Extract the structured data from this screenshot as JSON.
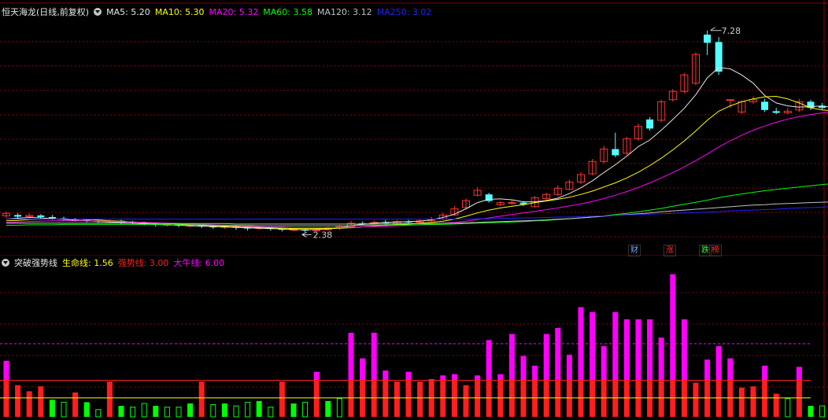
{
  "main_legend": {
    "stock_title": "恒天海龙(日线,前复权)",
    "items": [
      {
        "label": "MA5: 5.20",
        "color": "#e6e6e6"
      },
      {
        "label": "MA10: 5.30",
        "color": "#ffff00"
      },
      {
        "label": "MA20: 5.32",
        "color": "#ff00ff"
      },
      {
        "label": "MA60: 3.58",
        "color": "#00ff00"
      },
      {
        "label": "MA120: 3.12",
        "color": "#c0c0c0"
      },
      {
        "label": "MA250: 3.02",
        "color": "#2222ff"
      }
    ]
  },
  "sub_legend": {
    "title": "突破强势线",
    "items": [
      {
        "label": "生命线: 1.56",
        "color": "#ffff00"
      },
      {
        "label": "强势线: 3.00",
        "color": "#ff2020"
      },
      {
        "label": "大牛线: 6.00",
        "color": "#ff00ff"
      }
    ]
  },
  "annotations": {
    "high_price": "7.28",
    "low_price": "2.38"
  },
  "badges": [
    {
      "text": "财",
      "color": "#6fa8ff"
    },
    {
      "text": "涨",
      "color": "#ff3030"
    },
    {
      "text": "跌",
      "color": "#30ff30"
    },
    {
      "text": "榜",
      "color": "#ff3030"
    }
  ],
  "colors": {
    "up": "#ff3232",
    "down": "#54ffff",
    "grid": "#8b0000"
  },
  "chart_data": [
    {
      "type": "candlestick",
      "title": "恒天海龙(日线,前复权)",
      "ylim": [
        2.1,
        7.6
      ],
      "candles": [
        [
          2.78,
          2.84,
          2.72,
          2.88
        ],
        [
          2.8,
          2.76,
          2.7,
          2.85
        ],
        [
          2.76,
          2.79,
          2.72,
          2.84
        ],
        [
          2.79,
          2.75,
          2.7,
          2.82
        ],
        [
          2.75,
          2.72,
          2.68,
          2.8
        ],
        [
          2.72,
          2.7,
          2.66,
          2.76
        ],
        [
          2.7,
          2.68,
          2.64,
          2.73
        ],
        [
          2.68,
          2.66,
          2.62,
          2.71
        ],
        [
          2.66,
          2.64,
          2.6,
          2.7
        ],
        [
          2.64,
          2.66,
          2.6,
          2.7
        ],
        [
          2.66,
          2.63,
          2.58,
          2.68
        ],
        [
          2.63,
          2.61,
          2.57,
          2.66
        ],
        [
          2.61,
          2.58,
          2.55,
          2.64
        ],
        [
          2.58,
          2.56,
          2.52,
          2.62
        ],
        [
          2.56,
          2.57,
          2.52,
          2.61
        ],
        [
          2.57,
          2.54,
          2.5,
          2.6
        ],
        [
          2.54,
          2.55,
          2.5,
          2.58
        ],
        [
          2.55,
          2.52,
          2.48,
          2.58
        ],
        [
          2.52,
          2.5,
          2.46,
          2.55
        ],
        [
          2.5,
          2.52,
          2.46,
          2.56
        ],
        [
          2.52,
          2.49,
          2.44,
          2.55
        ],
        [
          2.49,
          2.47,
          2.42,
          2.52
        ],
        [
          2.47,
          2.49,
          2.44,
          2.52
        ],
        [
          2.49,
          2.46,
          2.42,
          2.51
        ],
        [
          2.46,
          2.44,
          2.4,
          2.49
        ],
        [
          2.44,
          2.45,
          2.4,
          2.48
        ],
        [
          2.45,
          2.42,
          2.38,
          2.47
        ],
        [
          2.42,
          2.44,
          2.38,
          2.47
        ],
        [
          2.44,
          2.48,
          2.42,
          2.52
        ],
        [
          2.48,
          2.52,
          2.44,
          2.56
        ],
        [
          2.52,
          2.6,
          2.48,
          2.66
        ],
        [
          2.6,
          2.58,
          2.54,
          2.64
        ],
        [
          2.58,
          2.62,
          2.55,
          2.66
        ],
        [
          2.62,
          2.6,
          2.56,
          2.68
        ],
        [
          2.6,
          2.64,
          2.57,
          2.68
        ],
        [
          2.64,
          2.62,
          2.58,
          2.68
        ],
        [
          2.62,
          2.66,
          2.6,
          2.7
        ],
        [
          2.66,
          2.7,
          2.63,
          2.75
        ],
        [
          2.7,
          2.8,
          2.68,
          2.86
        ],
        [
          2.8,
          2.95,
          2.78,
          3.02
        ],
        [
          2.98,
          3.15,
          2.96,
          3.2
        ],
        [
          3.28,
          3.4,
          3.25,
          3.48
        ],
        [
          3.3,
          3.14,
          3.1,
          3.34
        ],
        [
          3.05,
          3.1,
          3.02,
          3.14
        ],
        [
          3.1,
          3.1,
          3.05,
          3.16
        ],
        [
          3.1,
          3.06,
          3.02,
          3.14
        ],
        [
          3.0,
          3.22,
          2.98,
          3.26
        ],
        [
          3.2,
          3.3,
          3.16,
          3.34
        ],
        [
          3.3,
          3.45,
          3.26,
          3.52
        ],
        [
          3.42,
          3.6,
          3.4,
          3.66
        ],
        [
          3.6,
          3.78,
          3.55,
          3.84
        ],
        [
          3.8,
          4.1,
          3.76,
          4.16
        ],
        [
          4.1,
          4.4,
          4.05,
          4.48
        ],
        [
          4.4,
          4.25,
          4.2,
          4.8
        ],
        [
          4.3,
          4.65,
          4.25,
          4.7
        ],
        [
          4.65,
          4.95,
          4.6,
          5.02
        ],
        [
          5.12,
          4.9,
          4.85,
          5.18
        ],
        [
          5.1,
          5.55,
          5.05,
          5.6
        ],
        [
          5.6,
          5.8,
          5.55,
          5.86
        ],
        [
          5.8,
          6.2,
          5.75,
          6.25
        ],
        [
          6.0,
          6.7,
          5.95,
          6.75
        ],
        [
          7.18,
          6.98,
          6.68,
          7.28
        ],
        [
          7.0,
          6.28,
          6.2,
          7.12
        ],
        [
          5.6,
          5.6,
          5.4,
          5.6
        ],
        [
          5.3,
          5.55,
          5.25,
          5.58
        ],
        [
          5.55,
          5.6,
          5.5,
          5.68
        ],
        [
          5.55,
          5.35,
          5.3,
          5.62
        ],
        [
          5.32,
          5.28,
          5.25,
          5.4
        ],
        [
          5.28,
          5.32,
          5.25,
          5.4
        ],
        [
          5.35,
          5.55,
          5.3,
          5.62
        ],
        [
          5.55,
          5.4,
          5.35,
          5.6
        ],
        [
          5.45,
          5.4,
          5.35,
          5.52
        ],
        [
          5.4,
          5.25,
          5.2,
          5.44
        ],
        [
          5.2,
          4.95,
          4.9,
          5.22
        ]
      ],
      "ma": [
        {
          "name": "MA5",
          "color": "#e6e6e6",
          "values": [
            2.7,
            2.72,
            2.74,
            2.73,
            2.71,
            2.69,
            2.67,
            2.66,
            2.64,
            2.63,
            2.62,
            2.6,
            2.58,
            2.57,
            2.56,
            2.55,
            2.54,
            2.53,
            2.52,
            2.51,
            2.5,
            2.49,
            2.48,
            2.47,
            2.46,
            2.45,
            2.44,
            2.45,
            2.46,
            2.49,
            2.54,
            2.57,
            2.6,
            2.62,
            2.63,
            2.64,
            2.65,
            2.68,
            2.74,
            2.82,
            2.95,
            3.1,
            3.18,
            3.19,
            3.17,
            3.12,
            3.12,
            3.15,
            3.21,
            3.32,
            3.46,
            3.63,
            3.83,
            4.02,
            4.23,
            4.46,
            4.62,
            4.86,
            5.12,
            5.39,
            5.72,
            6.13,
            6.38,
            6.35,
            6.2,
            6.0,
            5.7,
            5.52,
            5.45,
            5.42,
            5.43,
            5.45,
            5.4,
            5.35
          ]
        },
        {
          "name": "MA10",
          "color": "#ffff00",
          "values": [
            2.66,
            2.67,
            2.69,
            2.7,
            2.71,
            2.7,
            2.7,
            2.69,
            2.68,
            2.66,
            2.65,
            2.63,
            2.62,
            2.6,
            2.59,
            2.58,
            2.57,
            2.55,
            2.54,
            2.53,
            2.52,
            2.51,
            2.5,
            2.49,
            2.48,
            2.47,
            2.47,
            2.47,
            2.47,
            2.48,
            2.49,
            2.51,
            2.53,
            2.55,
            2.57,
            2.58,
            2.6,
            2.62,
            2.65,
            2.7,
            2.77,
            2.85,
            2.92,
            2.97,
            3.01,
            3.05,
            3.1,
            3.14,
            3.18,
            3.23,
            3.3,
            3.38,
            3.48,
            3.58,
            3.7,
            3.84,
            4.0,
            4.18,
            4.38,
            4.6,
            4.84,
            5.1,
            5.32,
            5.45,
            5.55,
            5.62,
            5.67,
            5.68,
            5.62,
            5.52,
            5.4,
            5.35,
            5.33,
            5.3
          ]
        },
        {
          "name": "MA20",
          "color": "#ff00ff",
          "values": [
            2.62,
            2.63,
            2.64,
            2.65,
            2.66,
            2.66,
            2.66,
            2.66,
            2.65,
            2.65,
            2.64,
            2.63,
            2.62,
            2.61,
            2.6,
            2.59,
            2.58,
            2.57,
            2.56,
            2.55,
            2.54,
            2.53,
            2.52,
            2.51,
            2.51,
            2.5,
            2.5,
            2.5,
            2.5,
            2.5,
            2.5,
            2.51,
            2.52,
            2.53,
            2.54,
            2.55,
            2.56,
            2.58,
            2.6,
            2.62,
            2.65,
            2.69,
            2.73,
            2.77,
            2.81,
            2.85,
            2.89,
            2.93,
            2.97,
            3.02,
            3.07,
            3.13,
            3.2,
            3.28,
            3.37,
            3.47,
            3.58,
            3.7,
            3.83,
            3.97,
            4.12,
            4.28,
            4.45,
            4.6,
            4.74,
            4.86,
            4.96,
            5.05,
            5.13,
            5.19,
            5.24,
            5.28,
            5.31,
            5.32
          ]
        },
        {
          "name": "MA60",
          "color": "#00ff00",
          "values": [
            2.55,
            2.55,
            2.56,
            2.56,
            2.56,
            2.57,
            2.57,
            2.57,
            2.57,
            2.57,
            2.57,
            2.57,
            2.57,
            2.57,
            2.56,
            2.56,
            2.56,
            2.56,
            2.55,
            2.55,
            2.55,
            2.55,
            2.54,
            2.54,
            2.54,
            2.54,
            2.54,
            2.54,
            2.54,
            2.54,
            2.54,
            2.55,
            2.55,
            2.55,
            2.56,
            2.56,
            2.56,
            2.57,
            2.57,
            2.58,
            2.59,
            2.6,
            2.61,
            2.62,
            2.63,
            2.64,
            2.66,
            2.67,
            2.69,
            2.71,
            2.73,
            2.75,
            2.78,
            2.81,
            2.84,
            2.88,
            2.92,
            2.96,
            3.01,
            3.06,
            3.11,
            3.16,
            3.22,
            3.27,
            3.31,
            3.35,
            3.39,
            3.42,
            3.45,
            3.48,
            3.51,
            3.54,
            3.56,
            3.58
          ]
        },
        {
          "name": "MA120",
          "color": "#c0c0c0",
          "values": [
            2.6,
            2.6,
            2.6,
            2.6,
            2.6,
            2.6,
            2.6,
            2.6,
            2.6,
            2.6,
            2.6,
            2.6,
            2.6,
            2.59,
            2.59,
            2.59,
            2.59,
            2.59,
            2.59,
            2.59,
            2.58,
            2.58,
            2.58,
            2.58,
            2.58,
            2.58,
            2.58,
            2.58,
            2.58,
            2.58,
            2.58,
            2.58,
            2.58,
            2.58,
            2.59,
            2.59,
            2.59,
            2.59,
            2.6,
            2.6,
            2.61,
            2.62,
            2.63,
            2.64,
            2.65,
            2.66,
            2.67,
            2.68,
            2.7,
            2.71,
            2.73,
            2.75,
            2.77,
            2.79,
            2.81,
            2.83,
            2.85,
            2.88,
            2.9,
            2.92,
            2.94,
            2.96,
            2.98,
            3.0,
            3.02,
            3.04,
            3.05,
            3.07,
            3.08,
            3.09,
            3.1,
            3.11,
            3.12,
            3.12
          ]
        },
        {
          "name": "MA250",
          "color": "#2222ff",
          "values": [
            2.7,
            2.7,
            2.7,
            2.7,
            2.7,
            2.7,
            2.7,
            2.7,
            2.7,
            2.7,
            2.7,
            2.7,
            2.7,
            2.7,
            2.7,
            2.7,
            2.7,
            2.7,
            2.7,
            2.7,
            2.7,
            2.7,
            2.7,
            2.7,
            2.7,
            2.7,
            2.7,
            2.7,
            2.7,
            2.7,
            2.7,
            2.7,
            2.7,
            2.7,
            2.7,
            2.7,
            2.7,
            2.7,
            2.7,
            2.7,
            2.7,
            2.71,
            2.71,
            2.72,
            2.72,
            2.73,
            2.73,
            2.74,
            2.75,
            2.75,
            2.76,
            2.77,
            2.78,
            2.79,
            2.8,
            2.81,
            2.82,
            2.83,
            2.84,
            2.85,
            2.86,
            2.87,
            2.88,
            2.9,
            2.91,
            2.92,
            2.93,
            2.94,
            2.96,
            2.97,
            2.98,
            2.99,
            3.01,
            3.02
          ]
        }
      ]
    },
    {
      "type": "bar",
      "title": "突破强势线",
      "ylim": [
        0,
        12
      ],
      "reference_lines": [
        {
          "name": "生命线",
          "value": 1.56,
          "color": "#ffff00"
        },
        {
          "name": "强势线",
          "value": 3.0,
          "color": "#ff2020"
        },
        {
          "name": "大牛线",
          "value": 6.0,
          "color": "#ff00ff"
        }
      ],
      "values": [
        4.6,
        2.6,
        2.1,
        2.5,
        1.4,
        1.2,
        2.0,
        1.2,
        0.6,
        2.9,
        0.9,
        0.8,
        1.1,
        0.9,
        0.8,
        0.8,
        1.1,
        2.9,
        1.0,
        1.1,
        0.9,
        1.2,
        1.3,
        0.8,
        2.9,
        1.1,
        1.2,
        3.7,
        1.3,
        1.5,
        6.9,
        4.8,
        6.9,
        3.8,
        2.9,
        3.7,
        2.9,
        3.1,
        3.4,
        3.5,
        2.6,
        3.4,
        6.3,
        3.5,
        6.8,
        5.0,
        4.2,
        6.8,
        7.3,
        5.1,
        9.0,
        8.6,
        5.8,
        8.6,
        8.0,
        8.0,
        8.0,
        6.5,
        11.7,
        8.0,
        2.8,
        4.7,
        5.8,
        4.8,
        2.4,
        2.5,
        4.2,
        1.9,
        1.5,
        4.1,
        0.9,
        0.9,
        1.3,
        2.0
      ]
    }
  ]
}
